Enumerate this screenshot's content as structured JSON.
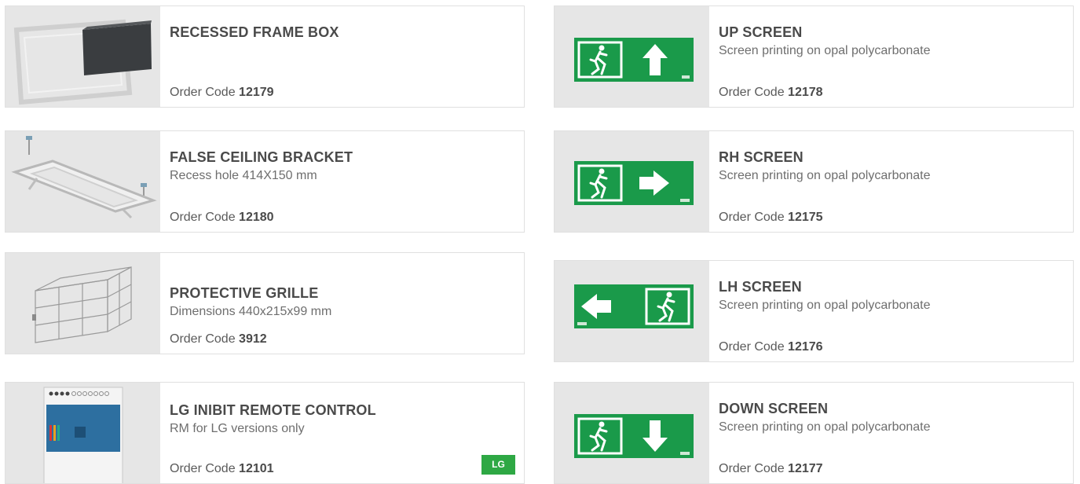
{
  "products": {
    "recessed_frame_box": {
      "title": "RECESSED FRAME BOX",
      "description": "",
      "order_label": "Order Code",
      "order_code": "12179"
    },
    "false_ceiling_bracket": {
      "title": "FALSE CEILING BRACKET",
      "description": "Recess hole 414X150 mm",
      "order_label": "Order Code",
      "order_code": "12180"
    },
    "protective_grille": {
      "title": "PROTECTIVE GRILLE",
      "description": "Dimensions 440x215x99 mm",
      "order_label": "Order Code",
      "order_code": "3912"
    },
    "lg_inibit_remote": {
      "title": "LG INIBIT REMOTE CONTROL",
      "description": "RM for LG versions only",
      "order_label": "Order Code",
      "order_code": "12101",
      "badge": "LG"
    },
    "up_screen": {
      "title": "UP SCREEN",
      "description": "Screen printing on opal polycarbonate",
      "order_label": "Order Code",
      "order_code": "12178"
    },
    "rh_screen": {
      "title": "RH SCREEN",
      "description": "Screen printing on opal polycarbonate",
      "order_label": "Order Code",
      "order_code": "12175"
    },
    "lh_screen": {
      "title": "LH SCREEN",
      "description": "Screen printing on opal polycarbonate",
      "order_label": "Order Code",
      "order_code": "12176"
    },
    "down_screen": {
      "title": "DOWN SCREEN",
      "description": "Screen printing on opal polycarbonate",
      "order_label": "Order Code",
      "order_code": "12177"
    }
  },
  "colors": {
    "sign_green": "#1a9a4a",
    "badge_green": "#2ea844",
    "thumb_bg": "#e6e6e6"
  },
  "icons": {
    "recessed_frame_box": "recessed-frame-box-image",
    "false_ceiling_bracket": "false-ceiling-bracket-image",
    "protective_grille": "protective-grille-image",
    "lg_inibit_remote": "remote-control-module-image",
    "up_screen": "exit-sign-up-arrow-icon",
    "rh_screen": "exit-sign-right-arrow-icon",
    "lh_screen": "exit-sign-left-arrow-icon",
    "down_screen": "exit-sign-down-arrow-icon"
  }
}
